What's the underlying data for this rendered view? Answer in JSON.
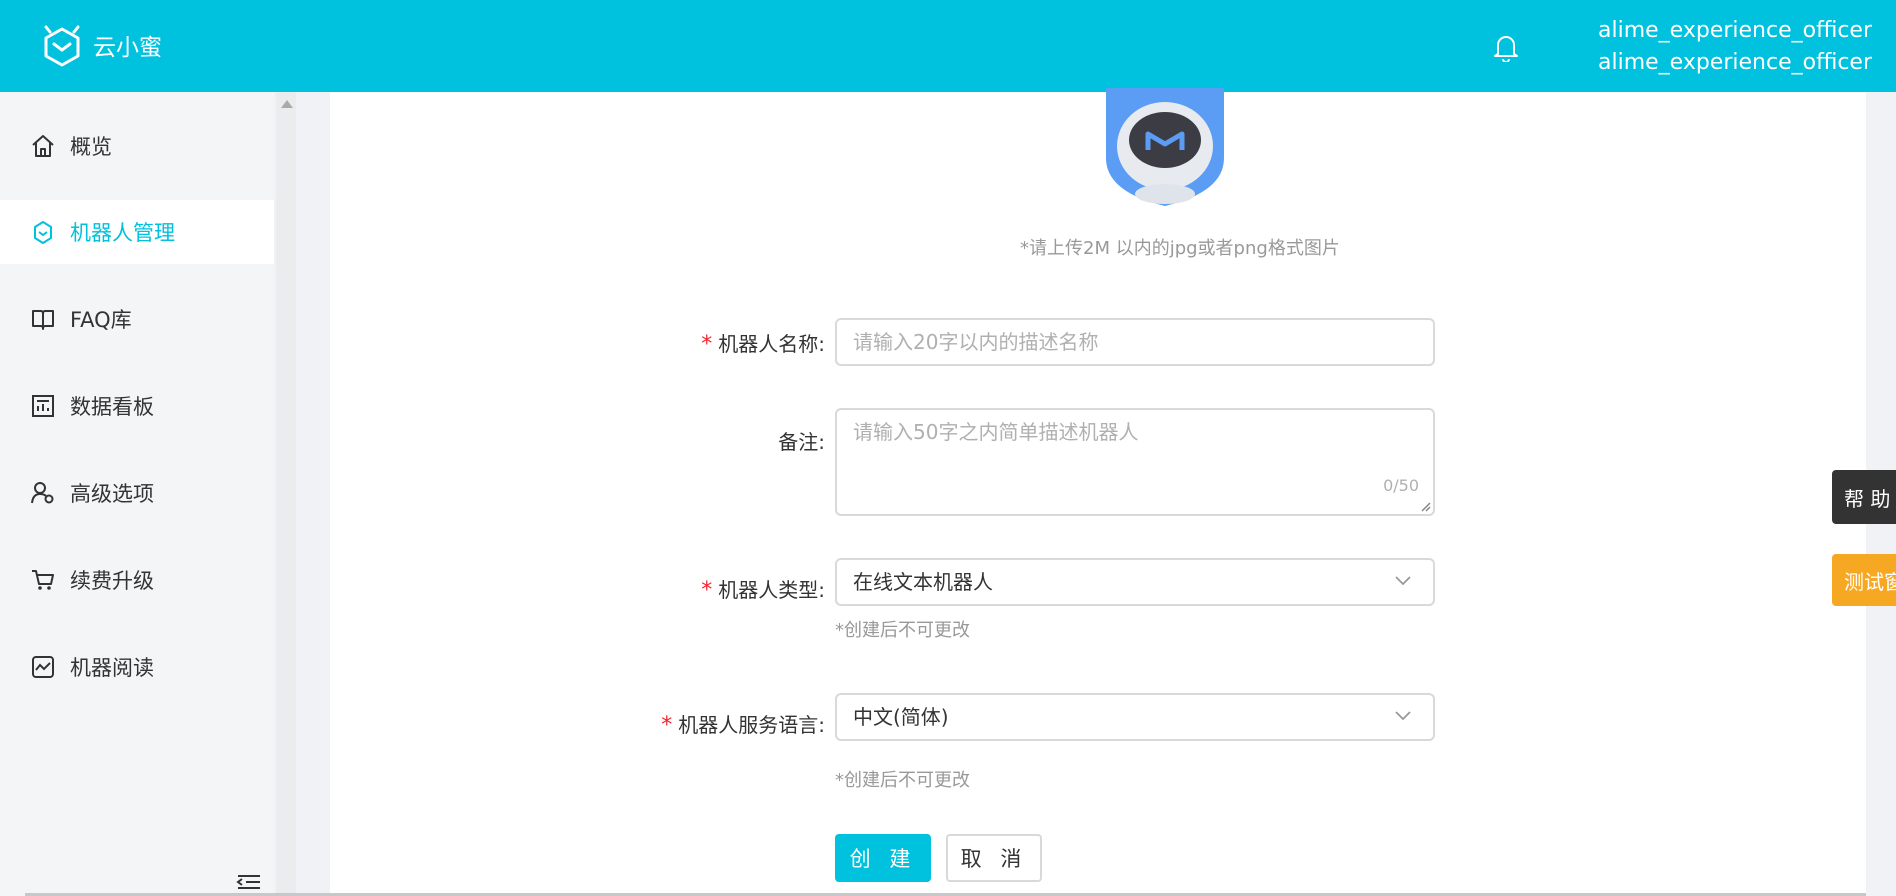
{
  "header": {
    "brand": "云小蜜",
    "user_line1": "alime_experience_officer",
    "user_line2": "alime_experience_officer"
  },
  "sidebar": {
    "items": [
      {
        "label": "概览",
        "icon": "home-icon"
      },
      {
        "label": "机器人管理",
        "icon": "robot-icon",
        "active": true
      },
      {
        "label": "FAQ库",
        "icon": "book-icon"
      },
      {
        "label": "数据看板",
        "icon": "dashboard-icon"
      },
      {
        "label": "高级选项",
        "icon": "users-gear-icon"
      },
      {
        "label": "续费升级",
        "icon": "cart-icon"
      },
      {
        "label": "机器阅读",
        "icon": "chart-icon"
      }
    ]
  },
  "form": {
    "upload_hint": "*请上传2M 以内的jpg或者png格式图片",
    "name_label": "机器人名称:",
    "name_placeholder": "请输入20字以内的描述名称",
    "remark_label": "备注:",
    "remark_placeholder": "请输入50字之内简单描述机器人",
    "remark_counter": "0/50",
    "type_label": "机器人类型:",
    "type_value": "在线文本机器人",
    "type_hint": "*创建后不可更改",
    "lang_label": "机器人服务语言:",
    "lang_value": "中文(简体)",
    "lang_hint": "*创建后不可更改",
    "create_button": "创 建",
    "cancel_button": "取 消"
  },
  "floats": {
    "help": "帮 助",
    "test": "测试窗口"
  },
  "colors": {
    "accent": "#00c1de",
    "required": "#f5222d",
    "test_tab": "#f7a823",
    "help_tab": "#333333"
  }
}
